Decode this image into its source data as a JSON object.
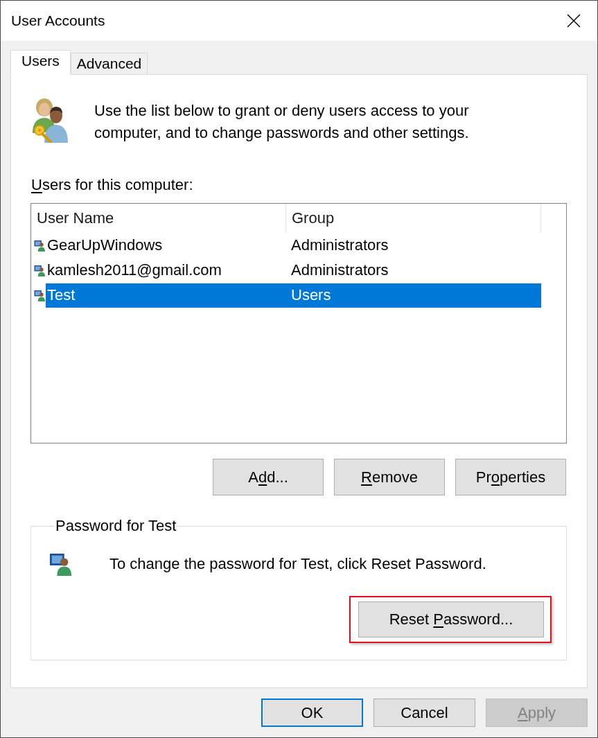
{
  "window": {
    "title": "User Accounts"
  },
  "tabs": [
    {
      "label": "Users",
      "selected": true
    },
    {
      "label": "Advanced",
      "selected": false
    }
  ],
  "intro": "Use the list below to grant or deny users access to your computer, and to change passwords and other settings.",
  "users_list": {
    "label": {
      "key": "U",
      "after": "sers for this computer:"
    },
    "columns": [
      "User Name",
      "Group"
    ],
    "rows": [
      {
        "user_name": "GearUpWindows",
        "group": "Administrators",
        "selected": false
      },
      {
        "user_name": "kamlesh2011@gmail.com",
        "group": "Administrators",
        "selected": false
      },
      {
        "user_name": "Test",
        "group": "Users",
        "selected": true
      }
    ]
  },
  "list_buttons": [
    {
      "label": {
        "before": "A",
        "key": "d",
        "after": "d..."
      }
    },
    {
      "label": {
        "key": "R",
        "after": "emove"
      }
    },
    {
      "label": {
        "before": "Pr",
        "key": "o",
        "after": "perties"
      }
    }
  ],
  "password_group": {
    "title": "Password for Test",
    "message": "To change the password for Test, click Reset Password.",
    "button": {
      "label": {
        "before": "Reset ",
        "key": "P",
        "after": "assword..."
      },
      "highlighted": true
    }
  },
  "dialog_buttons": [
    {
      "label": {
        "before": "OK"
      },
      "default": true,
      "disabled": false
    },
    {
      "label": {
        "before": "Cancel"
      },
      "default": false,
      "disabled": false
    },
    {
      "label": {
        "key": "A",
        "after": "pply"
      },
      "default": false,
      "disabled": true
    }
  ]
}
